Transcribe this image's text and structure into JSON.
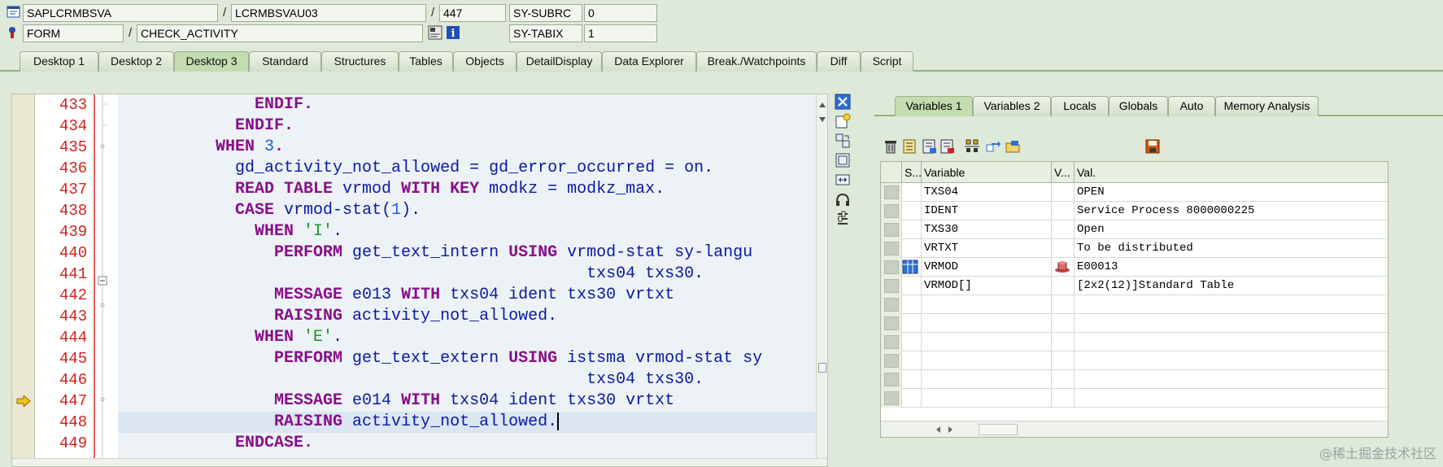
{
  "info": {
    "program": "SAPLCRMBSVA",
    "include": "LCRMBSVAU03",
    "line_no": "447",
    "sysfield1_name": "SY-SUBRC",
    "sysfield1_value": "0",
    "event_type": "FORM",
    "event_name": "CHECK_ACTIVITY",
    "sysfield2_name": "SY-TABIX",
    "sysfield2_value": "1",
    "slash": "/"
  },
  "desktop_tabs": [
    "Desktop 1",
    "Desktop 2",
    "Desktop 3",
    "Standard",
    "Structures",
    "Tables",
    "Objects",
    "DetailDisplay",
    "Data Explorer",
    "Break./Watchpoints",
    "Diff",
    "Script"
  ],
  "active_desktop_tab": "Desktop 3",
  "editor": {
    "lines": [
      {
        "n": "433",
        "tokens": [
          [
            "kw",
            "              ENDIF."
          ]
        ]
      },
      {
        "n": "434",
        "tokens": [
          [
            "kw",
            "            ENDIF."
          ]
        ]
      },
      {
        "n": "435",
        "tokens": [
          [
            "kw",
            "          WHEN "
          ],
          [
            "num",
            "3"
          ],
          [
            "kw",
            "."
          ]
        ]
      },
      {
        "n": "436",
        "tokens": [
          [
            "id",
            "            gd_activity_not_allowed = gd_error_occurred = on."
          ]
        ]
      },
      {
        "n": "437",
        "tokens": [
          [
            "kw",
            "            READ TABLE "
          ],
          [
            "id",
            "vrmod "
          ],
          [
            "kw",
            "WITH KEY "
          ],
          [
            "id",
            "modkz = modkz_max."
          ]
        ]
      },
      {
        "n": "438",
        "tokens": [
          [
            "kw",
            "            CASE "
          ],
          [
            "id",
            "vrmod-stat("
          ],
          [
            "num",
            "1"
          ],
          [
            "id",
            ")."
          ]
        ]
      },
      {
        "n": "439",
        "tokens": [
          [
            "kw",
            "              WHEN "
          ],
          [
            "str",
            "'I'"
          ],
          [
            "id",
            "."
          ]
        ]
      },
      {
        "n": "440",
        "tokens": [
          [
            "kw",
            "                PERFORM "
          ],
          [
            "id",
            "get_text_intern "
          ],
          [
            "kw",
            "USING "
          ],
          [
            "id",
            "vrmod-stat sy-langu"
          ]
        ]
      },
      {
        "n": "441",
        "tokens": [
          [
            "id",
            "                                                txs04 txs30."
          ]
        ]
      },
      {
        "n": "442",
        "tokens": [
          [
            "kw",
            "                MESSAGE "
          ],
          [
            "id",
            "e013 "
          ],
          [
            "kw",
            "WITH "
          ],
          [
            "id",
            "txs04 ident txs30 vrtxt"
          ]
        ]
      },
      {
        "n": "443",
        "tokens": [
          [
            "kw",
            "                RAISING "
          ],
          [
            "id",
            "activity_not_allowed."
          ]
        ]
      },
      {
        "n": "444",
        "tokens": [
          [
            "kw",
            "              WHEN "
          ],
          [
            "str",
            "'E'"
          ],
          [
            "id",
            "."
          ]
        ]
      },
      {
        "n": "445",
        "tokens": [
          [
            "kw",
            "                PERFORM "
          ],
          [
            "id",
            "get_text_extern "
          ],
          [
            "kw",
            "USING "
          ],
          [
            "id",
            "istsma vrmod-stat sy"
          ]
        ]
      },
      {
        "n": "446",
        "tokens": [
          [
            "id",
            "                                                txs04 txs30."
          ]
        ]
      },
      {
        "n": "447",
        "tokens": [
          [
            "kw",
            "                MESSAGE "
          ],
          [
            "id",
            "e014 "
          ],
          [
            "kw",
            "WITH "
          ],
          [
            "id",
            "txs04 ident txs30 vrtxt"
          ]
        ]
      },
      {
        "n": "448",
        "tokens": [
          [
            "kw",
            "                RAISING "
          ],
          [
            "id",
            "activity_not_allowed."
          ]
        ]
      },
      {
        "n": "449",
        "tokens": [
          [
            "kw",
            "            ENDCASE."
          ]
        ]
      }
    ],
    "current_line": "447",
    "cursor_line": "448"
  },
  "var_tabs": [
    "Variables 1",
    "Variables 2",
    "Locals",
    "Globals",
    "Auto",
    "Memory Analysis"
  ],
  "active_var_tab": "Variables 1",
  "grid": {
    "headers": {
      "s": "S...",
      "variable": "Variable",
      "v": "V...",
      "val": "Val."
    },
    "rows": [
      {
        "variable": "TXS04",
        "value": "OPEN",
        "icon": ""
      },
      {
        "variable": "IDENT",
        "value": "Service Process 8000000225",
        "icon": ""
      },
      {
        "variable": "TXS30",
        "value": "Open",
        "icon": ""
      },
      {
        "variable": "VRTXT",
        "value": "To be distributed",
        "icon": ""
      },
      {
        "variable": "VRMOD",
        "value": "E00013",
        "icon": "structure-icon"
      },
      {
        "variable": "VRMOD[]",
        "value": "[2x2(12)]Standard Table",
        "icon": ""
      }
    ]
  },
  "colors": {
    "background": "#dfe9d9",
    "keyword": "#8a0d8a",
    "identifier": "#0a1aa0",
    "line_number": "#d42020",
    "string": "#1a9a1a"
  },
  "watermark": "@稀土掘金技术社区"
}
